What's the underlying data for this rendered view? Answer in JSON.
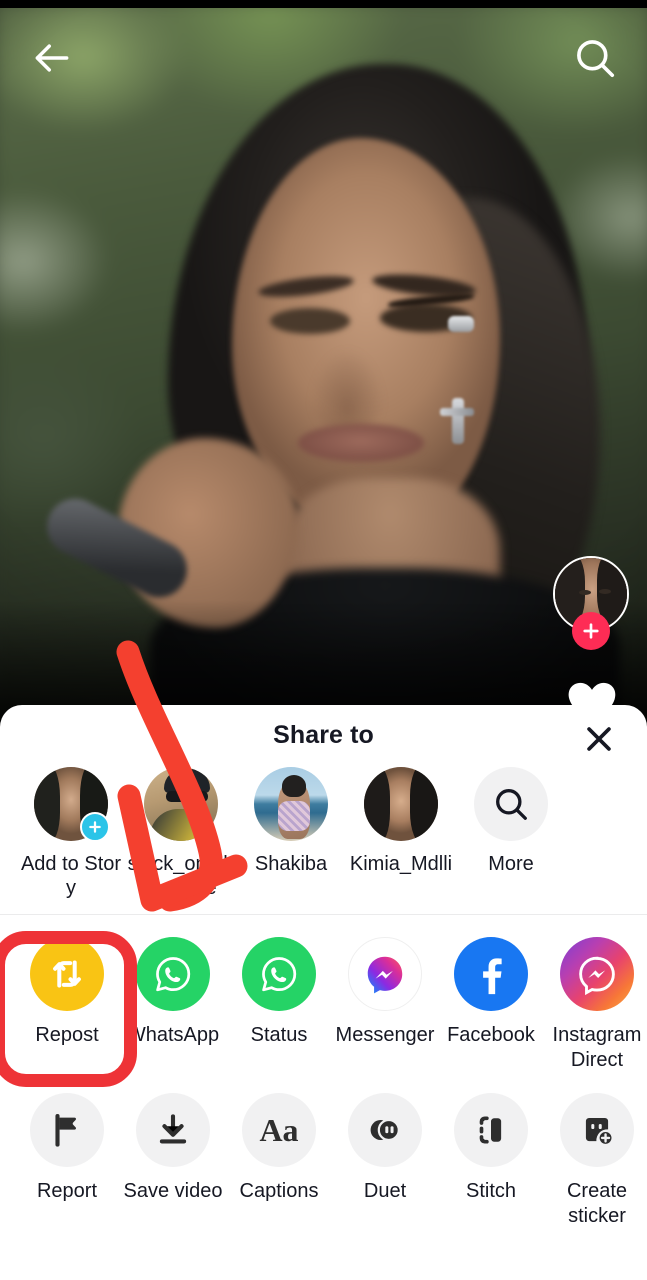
{
  "screen": {
    "app": "TikTok",
    "context": "video-player-with-share-sheet"
  },
  "topbar": {
    "back_icon": "back-arrow-icon",
    "back_label": "Back",
    "search_icon": "search-icon",
    "search_label": "Search"
  },
  "video": {
    "description": "Blurred close-up of a woman singing into a silver handheld microphone in front of green foliage",
    "author_avatar": "author-avatar",
    "follow_icon": "plus-icon",
    "follow_color": "#FE2C55",
    "like_icon": "heart-icon"
  },
  "sheet": {
    "title": "Share to",
    "close_icon": "close-x-icon",
    "friends": [
      {
        "label": "Add to Story",
        "avatar": "own-avatar",
        "badge": "plus-icon",
        "badge_color": "#2BC4E8",
        "type": "story"
      },
      {
        "label": "si_ck_on_the_move",
        "display": "si_ck_on_t\nhe_move",
        "avatar": "friend-avatar-cyclist",
        "type": "friend"
      },
      {
        "label": "Shakiba",
        "avatar": "friend-avatar-beach",
        "type": "friend"
      },
      {
        "label": "Kimia_Mdlli",
        "avatar": "friend-avatar-portrait",
        "type": "friend"
      },
      {
        "label": "More",
        "avatar": "search-icon",
        "type": "more"
      }
    ],
    "apps": [
      {
        "label": "Repost",
        "icon": "repost-icon",
        "color": "#F9C414",
        "highlighted": true
      },
      {
        "label": "WhatsApp",
        "icon": "whatsapp-icon",
        "color": "#25D366"
      },
      {
        "label": "Status",
        "icon": "whatsapp-status-icon",
        "color": "#25D366"
      },
      {
        "label": "Messenger",
        "icon": "messenger-icon",
        "color": "#FFFFFF"
      },
      {
        "label": "Facebook",
        "icon": "facebook-icon",
        "color": "#1877F2"
      },
      {
        "label": "Instagram Direct",
        "icon": "instagram-direct-icon",
        "color": "#E8436D"
      }
    ],
    "actions": [
      {
        "label": "Report",
        "icon": "flag-icon"
      },
      {
        "label": "Save video",
        "icon": "download-icon"
      },
      {
        "label": "Captions",
        "icon": "captions-aa-icon",
        "glyph": "Aa"
      },
      {
        "label": "Duet",
        "icon": "duet-icon"
      },
      {
        "label": "Stitch",
        "icon": "stitch-icon"
      },
      {
        "label": "Create sticker",
        "icon": "create-sticker-icon"
      }
    ]
  },
  "annotations": {
    "highlight_box": {
      "target": "Repost",
      "color": "#EE3337",
      "shape": "rounded-rectangle"
    },
    "arrow": {
      "color": "#F4402F",
      "points_to": "si_ck_on_the_move",
      "shape": "curved-down-arrow"
    }
  }
}
